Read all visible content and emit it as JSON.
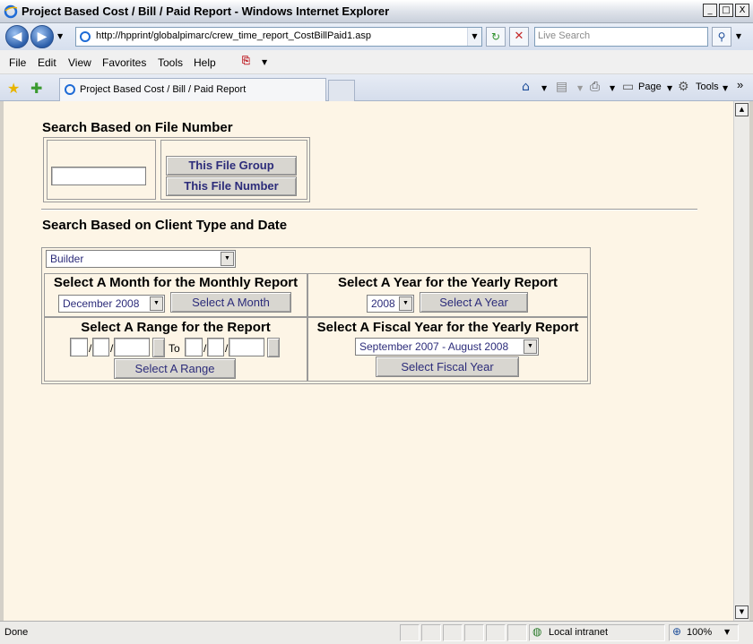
{
  "window": {
    "title": "Project Based Cost / Bill / Paid Report - Windows Internet Explorer",
    "controls": [
      "_",
      "□",
      "X"
    ]
  },
  "address": {
    "url": "http://hpprint/globalpimarc/crew_time_report_CostBillPaid1.asp",
    "search_placeholder": "Live Search"
  },
  "menu": [
    "File",
    "Edit",
    "View",
    "Favorites",
    "Tools",
    "Help"
  ],
  "tab": {
    "label": "Project Based Cost / Bill / Paid Report"
  },
  "commandbar": {
    "page_label": "Page",
    "tools_label": "Tools",
    "more": "»"
  },
  "page": {
    "file_section": {
      "heading": "Search Based on File Number",
      "file_number_value": "",
      "group_button": "This File Group",
      "number_button": "This File Number"
    },
    "client_section": {
      "heading": "Search Based on Client Type and Date",
      "client_type_selected": "Builder",
      "monthly": {
        "title": "Select A Month for the Monthly Report",
        "month_selected": "December 2008",
        "button": "Select A Month"
      },
      "yearly": {
        "title": "Select A Year for the Yearly Report",
        "year_selected": "2008",
        "button": "Select A Year"
      },
      "range": {
        "title": "Select A Range for the Report",
        "separator": "/",
        "to_label": "To",
        "button": "Select A Range"
      },
      "fiscal": {
        "title": "Select A Fiscal Year for the Yearly Report",
        "fiscal_selected": "September 2007 - August 2008",
        "button": "Select Fiscal Year"
      }
    }
  },
  "status": {
    "text": "Done",
    "zone": "Local intranet",
    "zoom": "100%"
  },
  "colors": {
    "page_background": "#fdf5e6",
    "button_text": "#2c2c7a",
    "chrome": "#d4d0c8"
  }
}
